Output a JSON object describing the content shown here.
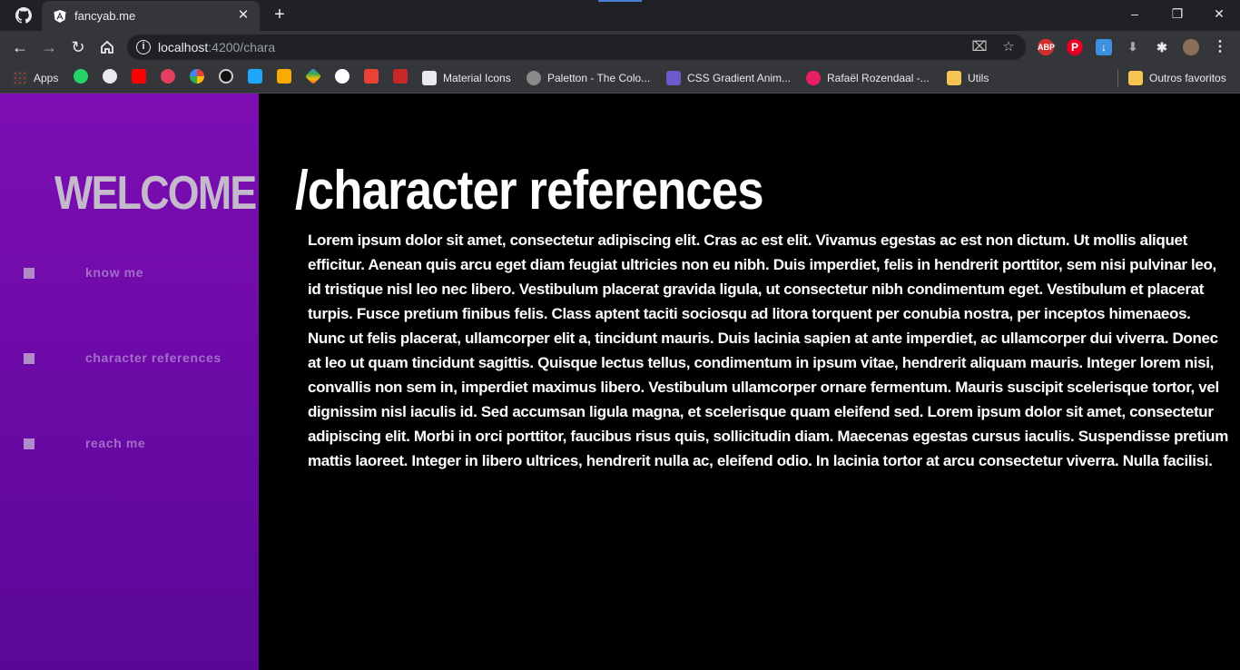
{
  "browser": {
    "tab": {
      "title": "fancyab.me",
      "favicon": "angular-icon"
    },
    "url": {
      "host": "localhost",
      "path": ":4200/chara"
    },
    "bookmarks": [
      {
        "label": "Apps",
        "icon": "apps-grid-icon"
      },
      {
        "label": "Material Icons",
        "icon": "material-icons-icon"
      },
      {
        "label": "Paletton - The Colo...",
        "icon": "paletton-icon"
      },
      {
        "label": "CSS Gradient Anim...",
        "icon": "css-gradient-icon"
      },
      {
        "label": "Rafaël Rozendaal -...",
        "icon": "rozendaal-icon"
      },
      {
        "label": "Utils",
        "icon": "folder-icon"
      },
      {
        "label": "Outros favoritos",
        "icon": "folder-icon"
      }
    ],
    "colors": {
      "tabbar": "#202124",
      "toolbar": "#35363a"
    }
  },
  "sidebar": {
    "welcome": "WELCOME",
    "items": [
      {
        "label": "know me"
      },
      {
        "label": "character references"
      },
      {
        "label": "reach me"
      }
    ],
    "colors": {
      "gradient_top": "#7d0eb3",
      "gradient_bottom": "#5a0796",
      "label": "#a56cc9"
    }
  },
  "main": {
    "heading": "/character references",
    "body": "Lorem ipsum dolor sit amet, consectetur adipiscing elit. Cras ac est elit. Vivamus egestas ac est non dictum. Ut mollis aliquet efficitur. Aenean quis arcu eget diam feugiat ultricies non eu nibh. Duis imperdiet, felis in hendrerit porttitor, sem nisi pulvinar leo, id tristique nisl leo nec libero. Vestibulum placerat gravida ligula, ut consectetur nibh condimentum eget. Vestibulum et placerat turpis. Fusce pretium finibus felis. Class aptent taciti sociosqu ad litora torquent per conubia nostra, per inceptos himenaeos. Nunc ut felis placerat, ullamcorper elit a, tincidunt mauris. Duis lacinia sapien at ante imperdiet, ac ullamcorper dui viverra. Donec at leo ut quam tincidunt sagittis. Quisque lectus tellus, condimentum in ipsum vitae, hendrerit aliquam mauris. Integer lorem nisi, convallis non sem in, imperdiet maximus libero. Vestibulum ullamcorper ornare fermentum. Mauris suscipit scelerisque tortor, vel dignissim nisl iaculis id. Sed accumsan ligula magna, et scelerisque quam eleifend sed. Lorem ipsum dolor sit amet, consectetur adipiscing elit. Morbi in orci porttitor, faucibus risus quis, sollicitudin diam. Maecenas egestas cursus iaculis. Suspendisse pretium mattis laoreet. Integer in libero ultrices, hendrerit nulla ac, eleifend odio. In lacinia tortor at arcu consectetur viverra. Nulla facilisi."
  }
}
